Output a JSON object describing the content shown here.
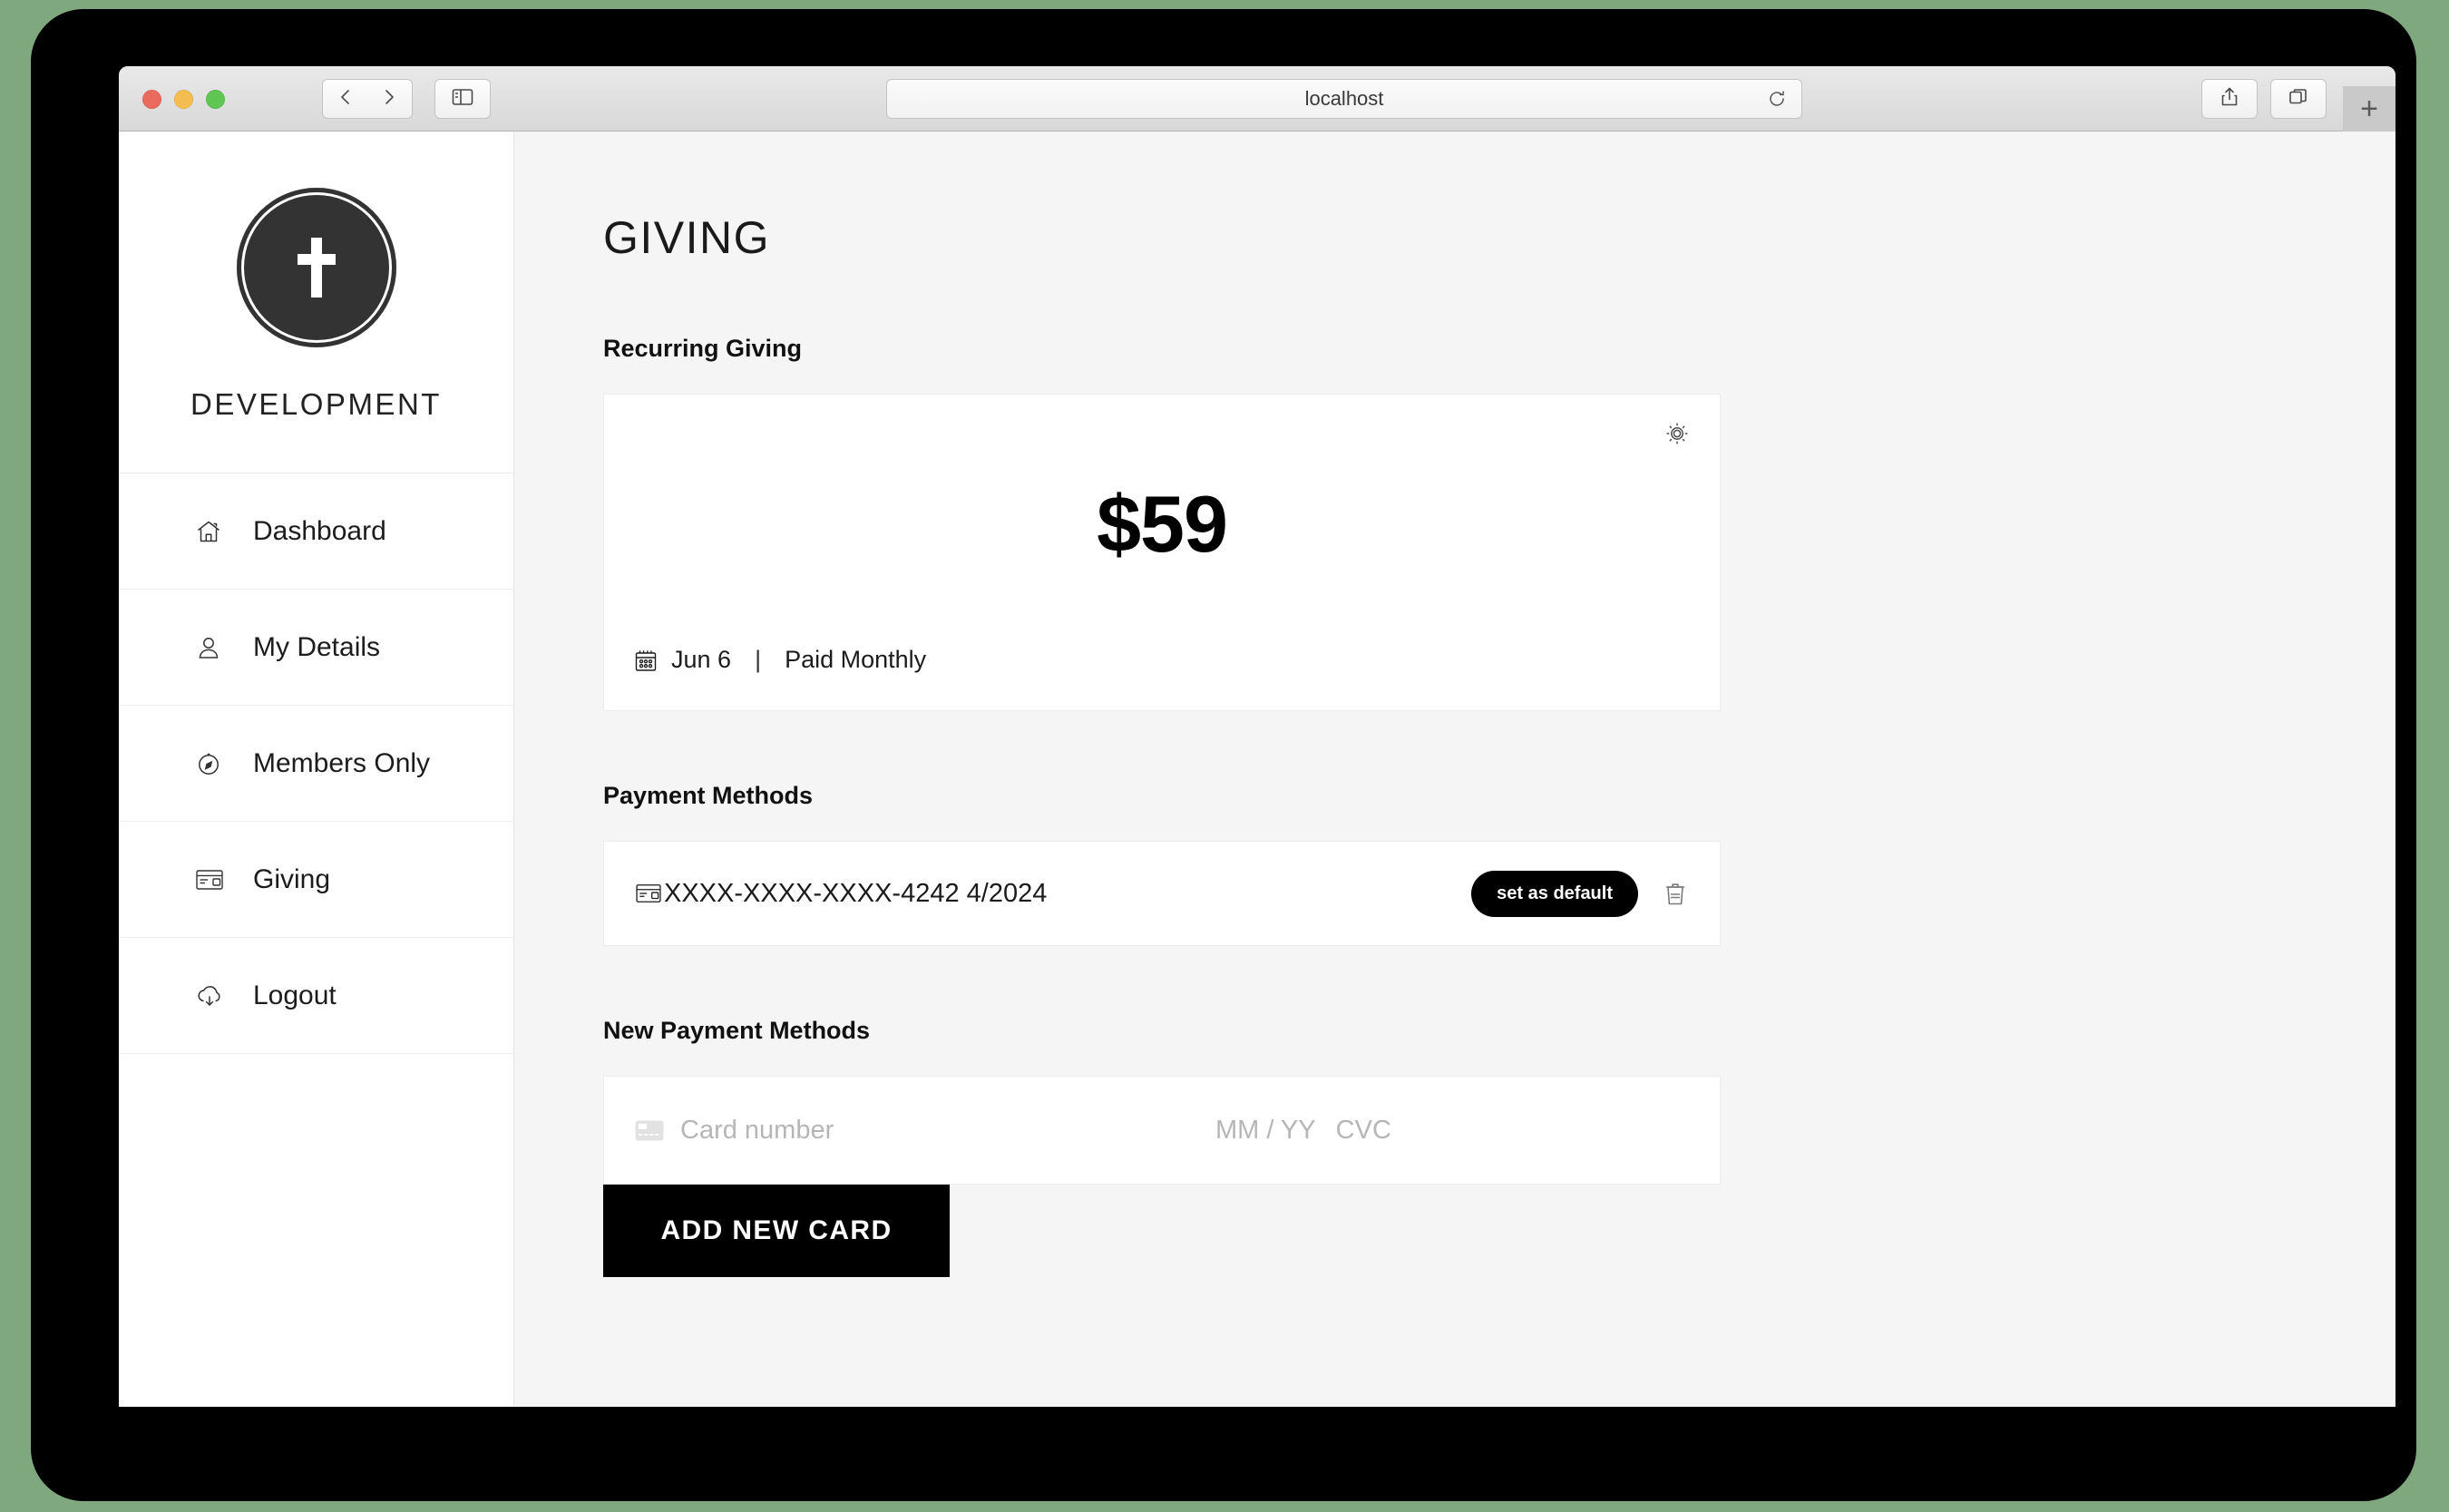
{
  "browser": {
    "url": "localhost",
    "icons": {
      "back": "chevron-left-icon",
      "forward": "chevron-right-icon",
      "sidebar": "sidebar-toggle-icon",
      "reload": "reload-icon",
      "share": "share-icon",
      "tabs": "tabs-icon",
      "new_tab_label": "+"
    }
  },
  "sidebar": {
    "brand_name": "DEVELOPMENT",
    "logo_icon": "cross-logo-icon",
    "items": [
      {
        "label": "Dashboard",
        "icon": "home-icon",
        "active": false
      },
      {
        "label": "My Details",
        "icon": "user-icon",
        "active": false
      },
      {
        "label": "Members Only",
        "icon": "compass-icon",
        "active": false
      },
      {
        "label": "Giving",
        "icon": "credit-card-icon",
        "active": true
      },
      {
        "label": "Logout",
        "icon": "cloud-download-icon",
        "active": false
      }
    ]
  },
  "main": {
    "page_title": "GIVING",
    "recurring": {
      "section_title": "Recurring Giving",
      "gear_icon": "gear-icon",
      "amount": "$59",
      "calendar_icon": "calendar-icon",
      "date": "Jun 6",
      "separator": "|",
      "frequency": "Paid Monthly"
    },
    "payment_methods": {
      "section_title": "Payment Methods",
      "rows": [
        {
          "card_icon": "credit-card-icon",
          "number": "XXXX-XXXX-XXXX-4242 4/2024",
          "set_default_label": "set as default",
          "delete_icon": "trash-icon"
        }
      ]
    },
    "new_payment": {
      "section_title": "New Payment Methods",
      "card_brand_icon": "credit-card-placeholder-icon",
      "card_number_placeholder": "Card number",
      "expiry_placeholder": "MM / YY",
      "cvc_placeholder": "CVC",
      "add_button_label": "ADD NEW CARD"
    }
  },
  "colors": {
    "accent": "#000000",
    "page_bg": "#f5f5f5",
    "card_bg": "#ffffff",
    "logo_bg": "#333333",
    "placeholder": "#b6b6b6"
  }
}
